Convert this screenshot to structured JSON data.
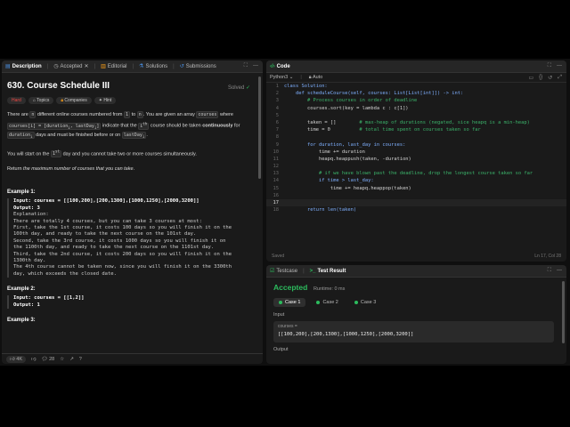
{
  "left_tabs": [
    {
      "label": "Description",
      "icon": "document-icon"
    },
    {
      "label": "Accepted",
      "icon": "clock-icon"
    },
    {
      "label": "Editorial",
      "icon": "book-icon"
    },
    {
      "label": "Solutions",
      "icon": "flask-icon"
    },
    {
      "label": "Submissions",
      "icon": "history-icon"
    }
  ],
  "problem": {
    "title": "630. Course Schedule III",
    "status": "Solved",
    "chips": [
      "Hard",
      "Topics",
      "Companies",
      "Hint"
    ],
    "p1_a": "There are ",
    "p1_n": "n",
    "p1_b": " different online courses numbered from ",
    "p1_1": "1",
    "p1_to": " to ",
    "p1_n2": "n",
    "p1_c": ". You are given an array ",
    "p1_courses": "courses",
    "p1_d": " where ",
    "p1_ci": "courses[i] = [duration",
    "p1_ci_sub": "i",
    "p1_ci2": ", lastDay",
    "p1_ci_sub2": "i",
    "p1_ci3": "]",
    "p1_e": " indicate that the ",
    "p1_ith": "i",
    "p1_ith_sup": "th",
    "p1_f": " course should be taken ",
    "p1_cont": "continuously",
    "p1_g": " for ",
    "p1_dur": "duration",
    "p1_dur_sub": "i",
    "p1_h": " days and must be finished before or on ",
    "p1_ld": "lastDay",
    "p1_ld_sub": "i",
    "p1_i": ".",
    "p2_a": "You will start on the ",
    "p2_1st": "1",
    "p2_1st_sup": "st",
    "p2_b": " day and you cannot take two or more courses simultaneously.",
    "p3_a": "Return ",
    "p3_b": "the maximum number of courses that you can take",
    "p3_c": ".",
    "example1_title": "Example 1:",
    "example1_lines": [
      "Input: courses = [[100,200],[200,1300],[1000,1250],[2000,3200]]",
      "Output: 3",
      "Explanation:",
      "There are totally 4 courses, but you can take 3 courses at most:",
      "First, take the 1st course, it costs 100 days so you will finish it on the",
      "100th day, and ready to take the next course on the 101st day.",
      "Second, take the 3rd course, it costs 1000 days so you will finish it on",
      "the 1100th day, and ready to take the next course on the 1101st day.",
      "Third, take the 2nd course, it costs 200 days so you will finish it on the",
      "1300th day.",
      "The 4th course cannot be taken now, since you will finish it on the 3300th",
      "day, which exceeds the closed date."
    ],
    "example2_title": "Example 2:",
    "example2_lines": [
      "Input: courses = [[1,2]]",
      "Output: 1"
    ],
    "example3_title": "Example 3:"
  },
  "left_footer": {
    "likes": "4K",
    "comments": "28"
  },
  "code_panel": {
    "title": "Code",
    "language": "Python3",
    "mode": "Auto",
    "lines": [
      {
        "n": "1",
        "text": "class Solution:"
      },
      {
        "n": "2",
        "text": "    def scheduleCourse(self, courses: List[List[int]]) -> int:"
      },
      {
        "n": "3",
        "text": "        # Process courses in order of deadline"
      },
      {
        "n": "4",
        "text": "        courses.sort(key = lambda c : c[1])"
      },
      {
        "n": "5",
        "text": ""
      },
      {
        "n": "6",
        "text": "        taken = []        # max-heap of durations (negated, sice heapq is a min-heap)"
      },
      {
        "n": "7",
        "text": "        time = 0          # total time spent on courses taken so far"
      },
      {
        "n": "8",
        "text": ""
      },
      {
        "n": "9",
        "text": "        for duration, last_day in courses:"
      },
      {
        "n": "10",
        "text": "            time += duration"
      },
      {
        "n": "11",
        "text": "            heapq.heappush(taken, -duration)"
      },
      {
        "n": "12",
        "text": ""
      },
      {
        "n": "13",
        "text": "            # if we have blown past the deadline, drop the longest course taken so far"
      },
      {
        "n": "14",
        "text": "            if time > last_day:"
      },
      {
        "n": "15",
        "text": "                time += heapq.heappop(taken)"
      },
      {
        "n": "16",
        "text": ""
      },
      {
        "n": "17",
        "text": ""
      },
      {
        "n": "18",
        "text": "        return len(taken)"
      }
    ],
    "saved": "Saved",
    "cursor": "Ln 17, Col 28"
  },
  "result_panel": {
    "tab_testcase": "Testcase",
    "tab_result": "Test Result",
    "status": "Accepted",
    "runtime": "Runtime: 0 ms",
    "cases": [
      "Case 1",
      "Case 2",
      "Case 3"
    ],
    "input_label": "Input",
    "var_name": "courses =",
    "var_value": "[[100,200],[200,1300],[1000,1250],[2000,3200]]",
    "output_label": "Output"
  },
  "colors": {
    "accepted": "#2cbb5d",
    "hard": "#ef4743",
    "accent": "#ffa116"
  }
}
